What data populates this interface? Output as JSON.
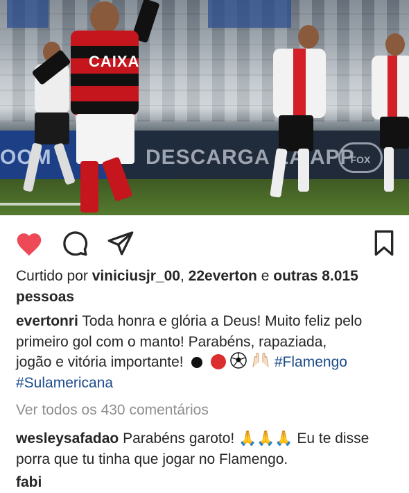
{
  "post": {
    "photo_ad_text_left": "OOM",
    "photo_ad_text": "DESCARGA LA APP",
    "photo_ad_logo": "FOX",
    "photo_shirt_text": "CAIXA"
  },
  "actions": {
    "like_icon": "heart-filled-icon",
    "comment_icon": "comment-icon",
    "share_icon": "send-icon",
    "save_icon": "bookmark-icon",
    "like_color": "#ed4956"
  },
  "likes": {
    "prefix": "Curtido por",
    "user1": "viniciusjr_00",
    "separator": ",",
    "user2": "22everton",
    "conjunction": "e",
    "others": "outras 8.015",
    "others_line2": "pessoas"
  },
  "caption": {
    "username": "evertonri",
    "line1": "Toda honra e glória a Deus! Muito feliz pelo",
    "line2": "primeiro gol com o manto! Parabéns, rapaziada,",
    "line3": "jogão e vitória importante!",
    "emojis": [
      "black-circle",
      "red-circle",
      "soccer-ball",
      "raised-hands"
    ],
    "hashtag1": "#Flamengo",
    "hashtag2": "#Sulamericana"
  },
  "view_comments": "Ver todos os 430 comentários",
  "comment": {
    "username": "wesleysafadao",
    "text1": "Parabéns garoto!",
    "emojis": [
      "praying-hands",
      "praying-hands",
      "praying-hands"
    ],
    "text2": "Eu te disse",
    "line2": "porra que tu tinha que jogar no Flamengo."
  },
  "next_comment_partial": "fabi"
}
